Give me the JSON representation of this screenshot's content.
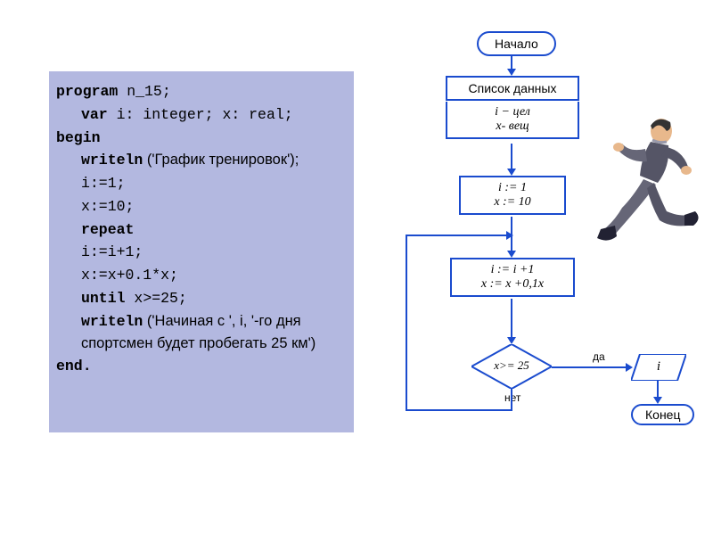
{
  "code": {
    "l1_kw": "program",
    "l1_rest": " n_15;",
    "l2_kw": "var",
    "l2_rest": " i: integer; x: real;",
    "l3_kw": "begin",
    "l4_kw": "writeln",
    "l4_rest": " ('График тренировок');",
    "l5": "i:=1;",
    "l6": "x:=10;",
    "l7_kw": "repeat",
    "l8": "i:=i+1;",
    "l9": "x:=x+0.1*x;",
    "l10_kw": "until",
    "l10_rest": " x>=25;",
    "l11_kw": "writeln",
    "l11_rest": " ('Начиная с ', i, '-го    дня спортсмен будет пробегать 25 км')",
    "l12_kw": "end."
  },
  "flow": {
    "start": "Начало",
    "data_title": "Список данных",
    "data_line1": "i − цел",
    "data_line2": "x- вещ",
    "init_line1": "i := 1",
    "init_line2": "x := 10",
    "body_line1": "i := i +1",
    "body_line2": "x := x +0,1x",
    "cond": "x>= 25",
    "yes": "да",
    "no": "нет",
    "output": "i",
    "end": "Конец"
  }
}
